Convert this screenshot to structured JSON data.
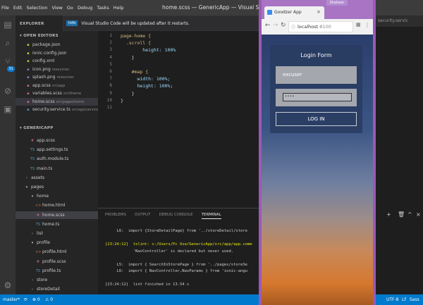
{
  "menu": [
    "File",
    "Edit",
    "Selection",
    "View",
    "Go",
    "Debug",
    "Tasks",
    "Help"
  ],
  "window_title": "home.scss — GenericApp — Visual Studio Code",
  "notification": {
    "badge": "Info",
    "text": "Visual Studio Code will be updated after it restarts."
  },
  "activity_badge": "31",
  "sidebar": {
    "explorer_label": "EXPLORER",
    "open_editors_label": "OPEN EDITORS",
    "open_editors": [
      {
        "name": "package.json",
        "desc": ""
      },
      {
        "name": "ionic.config.json",
        "desc": ""
      },
      {
        "name": "config.xml",
        "desc": ""
      },
      {
        "name": "icon.png",
        "desc": "resources"
      },
      {
        "name": "splash.png",
        "desc": "resources"
      },
      {
        "name": "app.scss",
        "desc": "src\\app"
      },
      {
        "name": "variables.scss",
        "desc": "src\\theme"
      },
      {
        "name": "home.scss",
        "desc": "src\\pages\\home"
      },
      {
        "name": "security.service.ts",
        "desc": "src\\app\\services"
      }
    ],
    "project_label": "GENERICAPP",
    "project_items": [
      {
        "name": "app.scss",
        "indent": 1,
        "icon": "css"
      },
      {
        "name": "app.settings.ts",
        "indent": 1,
        "icon": "ts"
      },
      {
        "name": "auth.module.ts",
        "indent": 1,
        "icon": "ts"
      },
      {
        "name": "main.ts",
        "indent": 1,
        "icon": "ts"
      },
      {
        "name": "assets",
        "indent": 0,
        "icon": "folder-closed"
      },
      {
        "name": "pages",
        "indent": 0,
        "icon": "folder-open"
      },
      {
        "name": "home",
        "indent": 1,
        "icon": "folder-open"
      },
      {
        "name": "home.html",
        "indent": 2,
        "icon": "html"
      },
      {
        "name": "home.scss",
        "indent": 2,
        "icon": "css"
      },
      {
        "name": "home.ts",
        "indent": 2,
        "icon": "ts"
      },
      {
        "name": "list",
        "indent": 1,
        "icon": "folder-closed"
      },
      {
        "name": "profile",
        "indent": 1,
        "icon": "folder-open"
      },
      {
        "name": "profile.html",
        "indent": 2,
        "icon": "html"
      },
      {
        "name": "profile.scss",
        "indent": 2,
        "icon": "css"
      },
      {
        "name": "profile.ts",
        "indent": 2,
        "icon": "ts"
      },
      {
        "name": "store",
        "indent": 1,
        "icon": "folder-closed"
      },
      {
        "name": "storeDetail",
        "indent": 1,
        "icon": "folder-closed"
      }
    ]
  },
  "editor": {
    "lines": [
      {
        "n": "1",
        "text": "page-home {"
      },
      {
        "n": "2",
        "text": "  .scroll {"
      },
      {
        "n": "3",
        "text": "        height: 100%"
      },
      {
        "n": "4",
        "text": "    }"
      },
      {
        "n": "5",
        "text": ""
      },
      {
        "n": "6",
        "text": "    #map {"
      },
      {
        "n": "7",
        "text": "      width: 100%;"
      },
      {
        "n": "8",
        "text": "      height: 100%;"
      },
      {
        "n": "9",
        "text": "    }"
      },
      {
        "n": "10",
        "text": "}"
      },
      {
        "n": "11",
        "text": ""
      }
    ]
  },
  "panel": {
    "tabs": [
      "PROBLEMS",
      "OUTPUT",
      "DEBUG CONSOLE",
      "TERMINAL"
    ],
    "terminal": [
      "     L6:  import {StoreDetailPage} from '../storeDetail/store",
      "",
      "[23:24:12]  tslint: c:/Users/Pc Use/GenericApp/src/app/app.comm",
      "            'NavController' is declared but never used.",
      "",
      "     L5:  import { SearchInStorePage } from '../pages/storeSe",
      "     L6:  import { NavController,NavParams } from 'ionic-angu",
      "",
      "[23:24:12]  lint finished in 13.54 s"
    ]
  },
  "statusbar": {
    "branch": "master*",
    "sync": "⟳",
    "errors": "⊗ 0",
    "warnings": "⚠ 0",
    "position": "Ln 3, Col 21",
    "spaces": "Spaces: 4",
    "encoding": "UTF-8",
    "eol": "LF",
    "language": "Sass"
  },
  "right_tab": "security.servic",
  "browser": {
    "tab_title": "Goodzer App",
    "profile": "Shaheer",
    "url_host": "localhost",
    "url_port": ":8100",
    "login": {
      "title": "Login Form",
      "username": "excuser",
      "password": "••••",
      "button": "LOG IN"
    }
  }
}
